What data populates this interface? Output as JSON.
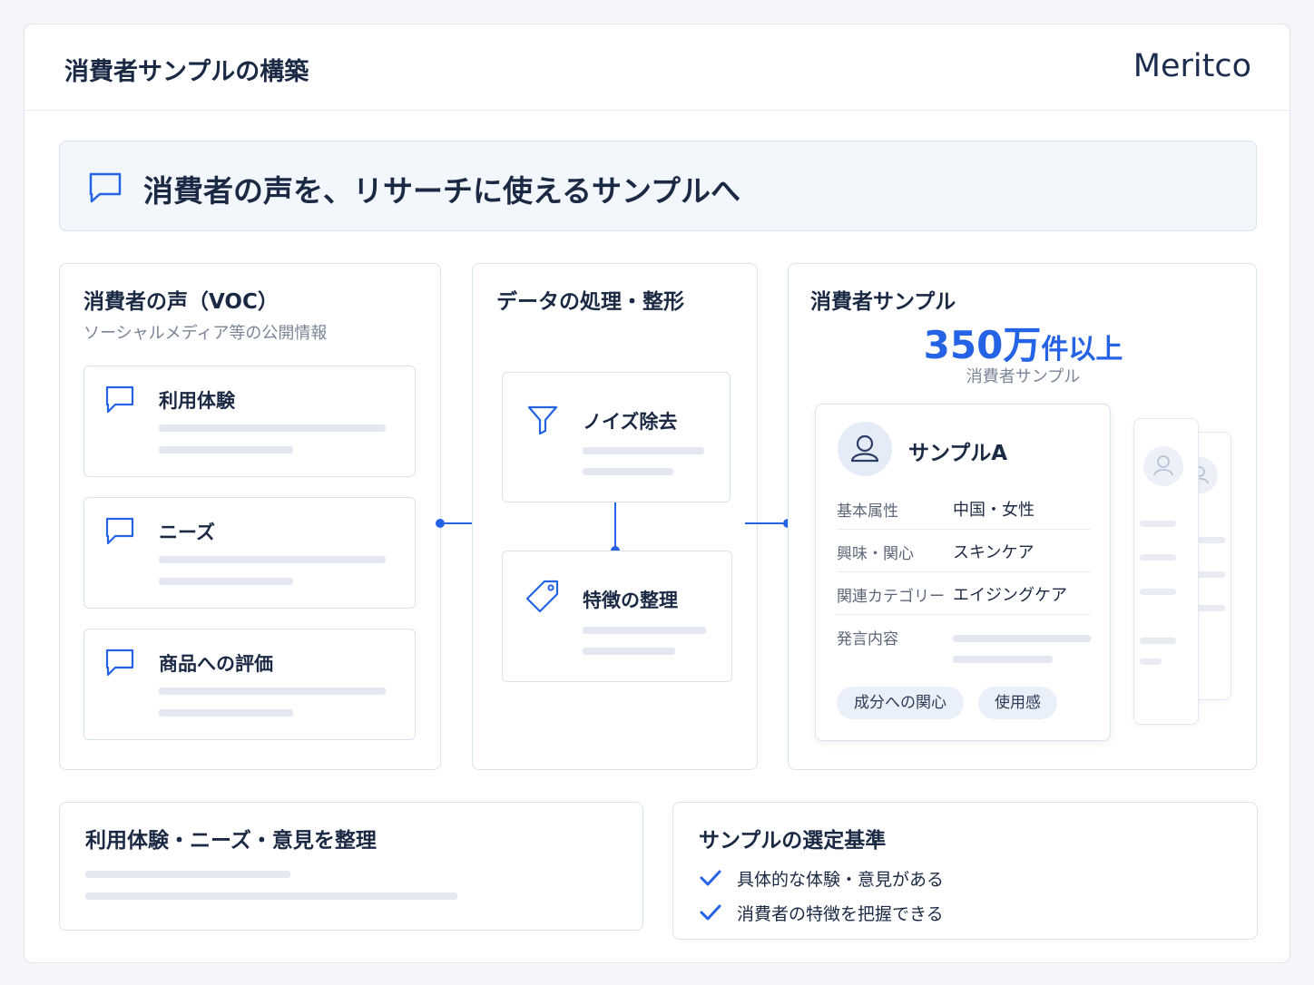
{
  "header": {
    "title": "消費者サンプルの構築",
    "logo": "Meritco"
  },
  "banner": {
    "text": "消費者の声を、リサーチに使えるサンプルへ",
    "icon": "chat-bubble-icon"
  },
  "voc": {
    "title": "消費者の声（VOC）",
    "subtitle": "ソーシャルメディア等の公開情報",
    "items": [
      {
        "label": "利用体験",
        "icon": "chat-bubble-icon"
      },
      {
        "label": "ニーズ",
        "icon": "chat-bubble-icon"
      },
      {
        "label": "商品への評価",
        "icon": "chat-bubble-icon"
      }
    ]
  },
  "processing": {
    "title": "データの処理・整形",
    "steps": [
      {
        "label": "ノイズ除去",
        "icon": "filter-icon"
      },
      {
        "label": "特徴の整理",
        "icon": "tag-icon"
      }
    ]
  },
  "samples": {
    "title": "消費者サンプル",
    "count_number": "350万",
    "count_suffix": "件以上",
    "count_caption": "消費者サンプル",
    "card": {
      "name": "サンプルA",
      "rows": [
        {
          "key": "基本属性",
          "value": "中国・女性"
        },
        {
          "key": "興味・関心",
          "value": "スキンケア"
        },
        {
          "key": "関連カテゴリー",
          "value": "エイジングケア"
        },
        {
          "key": "発言内容",
          "value": ""
        }
      ],
      "tags": [
        "成分への関心",
        "使用感"
      ]
    }
  },
  "summary": {
    "title": "利用体験・ニーズ・意見を整理"
  },
  "criteria": {
    "title": "サンプルの選定基準",
    "items": [
      "具体的な体験・意見がある",
      "消費者の特徴を把握できる"
    ]
  },
  "colors": {
    "accent": "#2462e6",
    "text": "#1b2a44",
    "muted": "#7a8597"
  }
}
